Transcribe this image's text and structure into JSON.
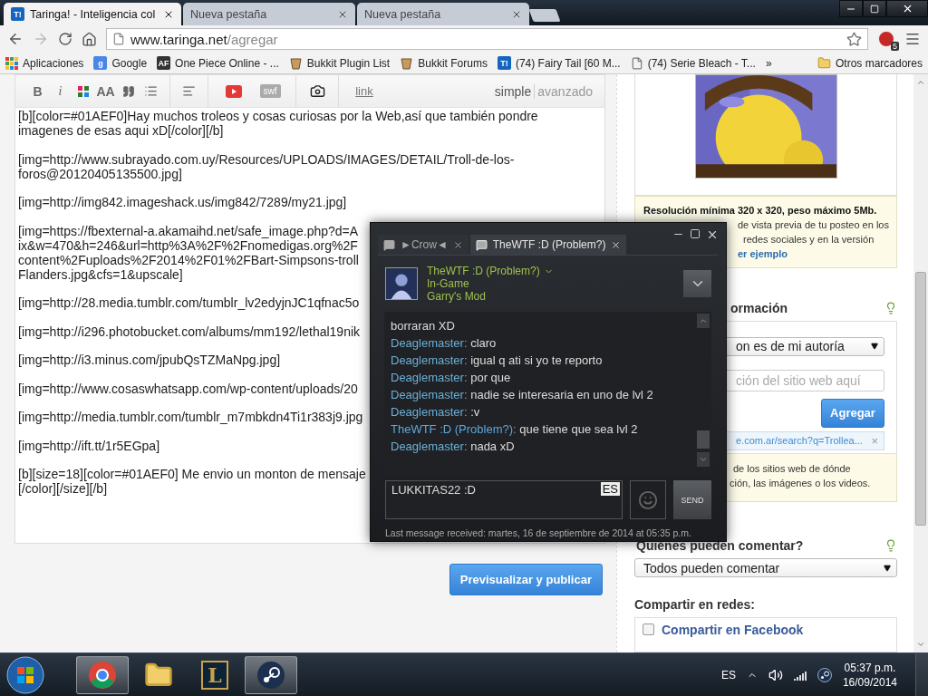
{
  "browser": {
    "tabs": [
      {
        "title": "Taringa! - Inteligencia col",
        "favicon": "T!",
        "selected": true
      },
      {
        "title": "Nueva pestaña",
        "selected": false
      },
      {
        "title": "Nueva pestaña",
        "selected": false
      }
    ],
    "address": {
      "host": "www.taringa.net",
      "path": "/agregar"
    },
    "extension_badge": "5",
    "bookmarks": [
      {
        "label": "Aplicaciones",
        "kind": "apps"
      },
      {
        "label": "Google",
        "kind": "letter",
        "icon_text": "g",
        "color": "#4a86e8"
      },
      {
        "label": "One Piece Online - ...",
        "kind": "letter",
        "icon_text": "AF",
        "color": "#333333"
      },
      {
        "label": "Bukkit Plugin List",
        "kind": "bucket"
      },
      {
        "label": "Bukkit Forums",
        "kind": "bucket"
      },
      {
        "label": "(74) Fairy Tail [60 M...",
        "kind": "letter",
        "icon_text": "T!",
        "color": "#1565c0"
      },
      {
        "label": "(74) Serie Bleach - T...",
        "kind": "page"
      }
    ],
    "bookmarks_more": "»",
    "other_bookmarks": "Otros marcadores"
  },
  "editor": {
    "toolbar": {
      "bold": "B",
      "italic": "i",
      "font_size": "AA",
      "swf": "swf",
      "link": "link",
      "modes": [
        {
          "label": "simple",
          "selected": true
        },
        {
          "label": "avanzado",
          "selected": false
        }
      ]
    },
    "paragraphs": [
      [
        "[b][color=#01AEF0]Hay muchos troleos y cosas curiosas por la Web,así que también pondre",
        "imagenes de esas aqui xD[/color][/b]"
      ],
      [
        "[img=http://www.subrayado.com.uy/Resources/UPLOADS/IMAGES/DETAIL/Troll-de-los-",
        "foros@20120405135500.jpg]"
      ],
      [
        "[img=http://img842.imageshack.us/img842/7289/my21.jpg]"
      ],
      [
        "[img=https://fbexternal-a.akamaihd.net/safe_image.php?d=A",
        "ix&w=470&h=246&url=http%3A%2F%2Fnomedigas.org%2F",
        "content%2Fuploads%2F2014%2F01%2FBart-Simpsons-troll",
        "Flanders.jpg&cfs=1&upscale]"
      ],
      [
        "[img=http://28.media.tumblr.com/tumblr_lv2edyjnJC1qfnac5o"
      ],
      [
        "[img=http://i296.photobucket.com/albums/mm192/lethal19nik"
      ],
      [
        "[img=http://i3.minus.com/jpubQsTZMaNpg.jpg]"
      ],
      [
        "[img=http://www.cosaswhatsapp.com/wp-content/uploads/20"
      ],
      [
        "[img=http://media.tumblr.com/tumblr_m7mbkdn4Ti1r383j9.jpg"
      ],
      [
        "[img=http://ift.tt/1r5EGpa]"
      ],
      [
        "[b][size=18][color=#01AEF0] Me envio un monton de mensaje",
        "[/color][/size][/b]"
      ]
    ],
    "publish": "Previsualizar y publicar"
  },
  "sidebar": {
    "notice": {
      "title": "Resolución mínima 320 x 320, peso máximo 5Mb.",
      "lines": [
        "de vista previa de tu posteo en los",
        "redes sociales y en la versión"
      ],
      "link": "er ejemplo"
    },
    "source": {
      "heading": "ormación",
      "select": "on es de mi autoría",
      "placeholder": "ción del sitio web aquí",
      "button": "Agregar",
      "chip": "e.com.ar/search?q=Trollea...",
      "chip_close": "×",
      "note_lines": [
        "de los sitios web de dónde",
        "ción, las imágenes o los videos."
      ]
    },
    "comments": {
      "heading": "Quiénes pueden comentar?",
      "select": "Todos pueden comentar"
    },
    "share": {
      "heading": "Compartir en redes:",
      "options": [
        {
          "label": "Compartir en Facebook",
          "checked": false
        }
      ]
    }
  },
  "chat": {
    "tabs": [
      {
        "title": "►Crow◄",
        "selected": false
      },
      {
        "title": "TheWTF :D (Problem?)",
        "selected": true
      }
    ],
    "friend": {
      "name": "TheWTF :D (Problem?)",
      "status": "In-Game",
      "game": "Garry's Mod"
    },
    "messages": [
      {
        "kind": "continued",
        "text": "borraran XD"
      },
      {
        "kind": "self",
        "sender": "Deaglemaster:",
        "text": "claro"
      },
      {
        "kind": "self",
        "sender": "Deaglemaster:",
        "text": "igual q ati si yo te reporto"
      },
      {
        "kind": "self",
        "sender": "Deaglemaster:",
        "text": "por que"
      },
      {
        "kind": "self",
        "sender": "Deaglemaster:",
        "text": "nadie se interesaria en uno de lvl 2"
      },
      {
        "kind": "self",
        "sender": "Deaglemaster:",
        "text": ":v"
      },
      {
        "kind": "friend",
        "sender": "TheWTF :D (Problem?):",
        "text": "que tiene que sea lvl 2"
      },
      {
        "kind": "self",
        "sender": "Deaglemaster:",
        "text": "nada xD"
      }
    ],
    "input": "LUKKITAS22 :D",
    "input_language": "ES",
    "send": "SEND",
    "footer": "Last message received: martes, 16 de septiembre de 2014 at 05:35 p.m."
  },
  "taskbar": {
    "apps": [
      {
        "kind": "chrome",
        "running": true
      },
      {
        "kind": "explorer",
        "running": false
      },
      {
        "kind": "lol",
        "label": "L",
        "running": false
      },
      {
        "kind": "steam",
        "running": true
      }
    ],
    "language": "ES",
    "time": "05:37 p.m.",
    "date": "16/09/2014"
  }
}
